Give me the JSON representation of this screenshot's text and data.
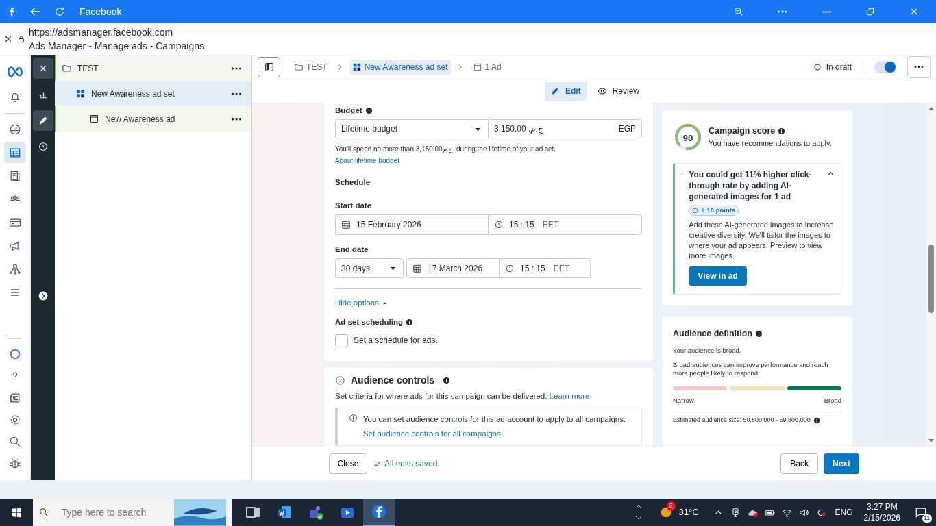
{
  "browser": {
    "title": "Facebook",
    "url": "https://adsmanager.facebook.com",
    "page_title": "Ads Manager - Manage ads - Campaigns"
  },
  "nav_rail": [
    {
      "selected": false
    },
    {
      "selected": false
    },
    {
      "selected": true
    },
    {
      "selected": false
    },
    {
      "selected": false
    },
    {
      "selected": false
    },
    {
      "selected": false
    },
    {
      "selected": false
    },
    {
      "selected": false
    }
  ],
  "nav_rail_bottom": [
    {
      "selected": false
    },
    {
      "selected": false
    },
    {
      "selected": false
    },
    {
      "selected": false
    },
    {
      "selected": false
    },
    {
      "selected": false
    }
  ],
  "tool_rail": [
    {
      "selected": false
    },
    {
      "selected": true
    },
    {
      "selected": false
    }
  ],
  "tree": [
    {
      "label": "TEST",
      "kind": "campaign",
      "selected": false,
      "children": [
        {
          "label": "New Awareness ad set",
          "kind": "adset",
          "selected": true,
          "children": [
            {
              "label": "New Awareness ad",
              "kind": "ad",
              "selected": false
            }
          ]
        }
      ]
    }
  ],
  "breadcrumb": [
    {
      "label": "TEST",
      "kind": "campaign",
      "selected": false
    },
    {
      "label": "New Awareness ad set",
      "kind": "adset",
      "selected": true
    },
    {
      "label": "1 Ad",
      "kind": "ad",
      "selected": false
    }
  ],
  "status": {
    "label": "In draft",
    "toggle_on": true
  },
  "mode_tabs": [
    {
      "label": "Edit",
      "kind": "edit",
      "selected": true
    },
    {
      "label": "Review",
      "kind": "review",
      "selected": false
    }
  ],
  "budget": {
    "label": "Budget",
    "type": "Lifetime budget",
    "amount": "ج.م. 3,150.00",
    "currency": "EGP",
    "note": "You'll spend no more than 3,150.00ج.م. during the lifetime of your ad set.",
    "link": "About lifetime budget"
  },
  "schedule": {
    "heading": "Schedule",
    "start_label": "Start date",
    "start_date": "15 February 2026",
    "start_time": "15 : 15",
    "start_zone": "EET",
    "end_label": "End date",
    "end_duration": "30 days",
    "end_date": "17 March 2026",
    "end_time": "15 : 15",
    "end_zone": "EET",
    "hide_options": "Hide options",
    "scheduling_label": "Ad set scheduling",
    "scheduling_checkbox": {
      "label": "Set a schedule for ads.",
      "checked": false
    }
  },
  "audience_controls": {
    "title": "Audience controls",
    "description": "Set criteria for where ads for this campaign can be delivered.",
    "link": "Learn more",
    "notice": "You can set audience controls for this ad account to apply to all campaigns.",
    "notice_link": "Set audience controls for all campaigns"
  },
  "campaign_score": {
    "score": "90",
    "level": 0.9,
    "title": "Campaign score",
    "subtitle": "You have recommendations to apply.",
    "recommendation": {
      "title": "You could get 11% higher click-through rate by adding AI-generated images for 1 ad",
      "points": "+ 10 points",
      "body": "Add these AI-generated images to increase creative diversity. We'll tailor the images to where your ad appears. Preview to view more images.",
      "button": "View in ad",
      "expanded": true
    }
  },
  "audience_definition": {
    "title": "Audience definition",
    "summary": "Your audience is broad.",
    "detail": "Broad audiences can improve performance and reach more people likely to respond.",
    "segments": [
      {
        "kind": "narrow",
        "selected": false
      },
      {
        "kind": "medium",
        "selected": false
      },
      {
        "kind": "broad",
        "selected": true
      }
    ],
    "min_label": "Narrow",
    "max_label": "Broad",
    "size": "Estimated audience size: 50,800,000 - 59,800,000"
  },
  "footer": {
    "close": "Close",
    "saved": "All edits saved",
    "back": "Back",
    "next": "Next"
  },
  "taskbar": {
    "search_placeholder": "Type here to search",
    "apps": [
      {
        "selected": false
      },
      {
        "selected": false
      },
      {
        "selected": false
      },
      {
        "selected": false
      },
      {
        "selected": true
      }
    ],
    "weather_badge": "2",
    "temperature": "31°C",
    "language": "ENG",
    "time": "3:27 PM",
    "date": "2/15/2026",
    "notifications": "11"
  }
}
